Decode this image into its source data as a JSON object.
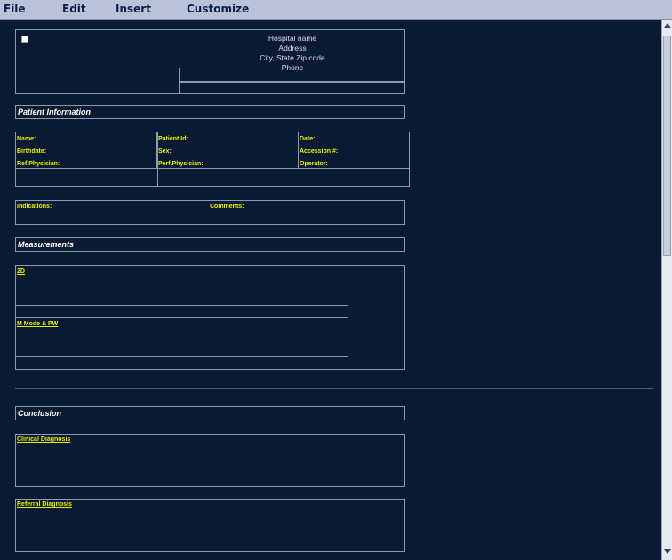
{
  "menu": {
    "file": "File",
    "edit": "Edit",
    "insert": "Insert",
    "customize": "Customize"
  },
  "hospital": {
    "name": "Hospital name",
    "address": "Address",
    "city": "City, State Zip code",
    "phone": "Phone"
  },
  "patient_section": {
    "title": "Patient Information",
    "name": "Name:",
    "birthdate": "Birthdate:",
    "ref_physician": "Ref.Physician:",
    "patient_id": "Patient Id:",
    "sex": "Sex:",
    "perf_physician": "Perf.Physician:",
    "date": "Date:",
    "accession": "Accession #:",
    "operator": "Operator:"
  },
  "indications": {
    "indications": "Indications:",
    "comments": "Comments:"
  },
  "measurements": {
    "title": "Measurements",
    "twod": "2D",
    "mmode": "M Mode & PW"
  },
  "conclusion": {
    "title": "Conclusion",
    "clinical": "Clinical Diagnosis",
    "referral": "Referral Diagnosis"
  },
  "colors": {
    "background": "#0a1a33",
    "label": "#e8f000",
    "border": "#8a9ab8",
    "menubar": "#b8c3da"
  }
}
